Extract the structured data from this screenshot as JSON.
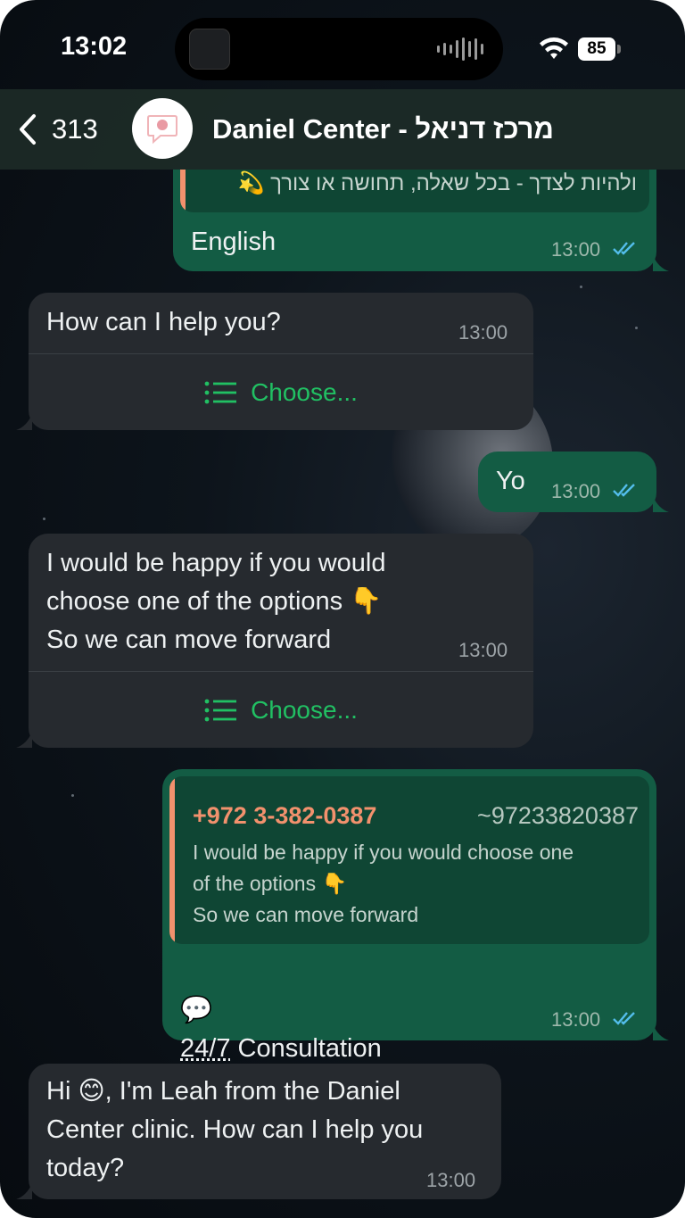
{
  "status_bar": {
    "time": "13:02",
    "battery": "85"
  },
  "header": {
    "back_count": "313",
    "contact_name": "Daniel Center - מרכז דניאל",
    "icons": [
      "chevron-left-icon",
      "wifi-icon",
      "battery-icon"
    ]
  },
  "messages": [
    {
      "direction": "outgoing",
      "partial_text": "ולהיות לצדך - בכל שאלה, תחושה או צורך 💫",
      "text": "English",
      "time": "13:00",
      "status": "read"
    },
    {
      "direction": "incoming",
      "text": "How can I help you?",
      "time": "13:00",
      "button_label": "Choose...",
      "button_icon": "list-icon"
    },
    {
      "direction": "outgoing",
      "text": "Yo",
      "time": "13:00",
      "status": "read"
    },
    {
      "direction": "incoming",
      "text": "I would be happy if you would\nchoose one of the options 👇\nSo we can move forward",
      "time": "13:00",
      "button_label": "Choose...",
      "button_icon": "list-icon"
    },
    {
      "direction": "outgoing",
      "quote": {
        "phone": "+972 3-382-0387",
        "alias": "~97233820387",
        "text": "I would be happy if you would choose one\nof the options 👇\nSo we can move forward"
      },
      "emoji": "💬",
      "text_underlined": "24/7",
      "text_rest": " Consultation",
      "time": "13:00",
      "status": "read"
    },
    {
      "direction": "incoming",
      "text": "Hi 😊, I'm Leah from the Daniel\nCenter clinic. How can I help you\ntoday?",
      "time": "13:00"
    }
  ],
  "colors": {
    "outgoing_bubble": "#135c44",
    "incoming_bubble": "#262a2f",
    "accent_green": "#21c063",
    "quote_accent": "#f2916d",
    "read_ticks": "#53bdeb"
  }
}
